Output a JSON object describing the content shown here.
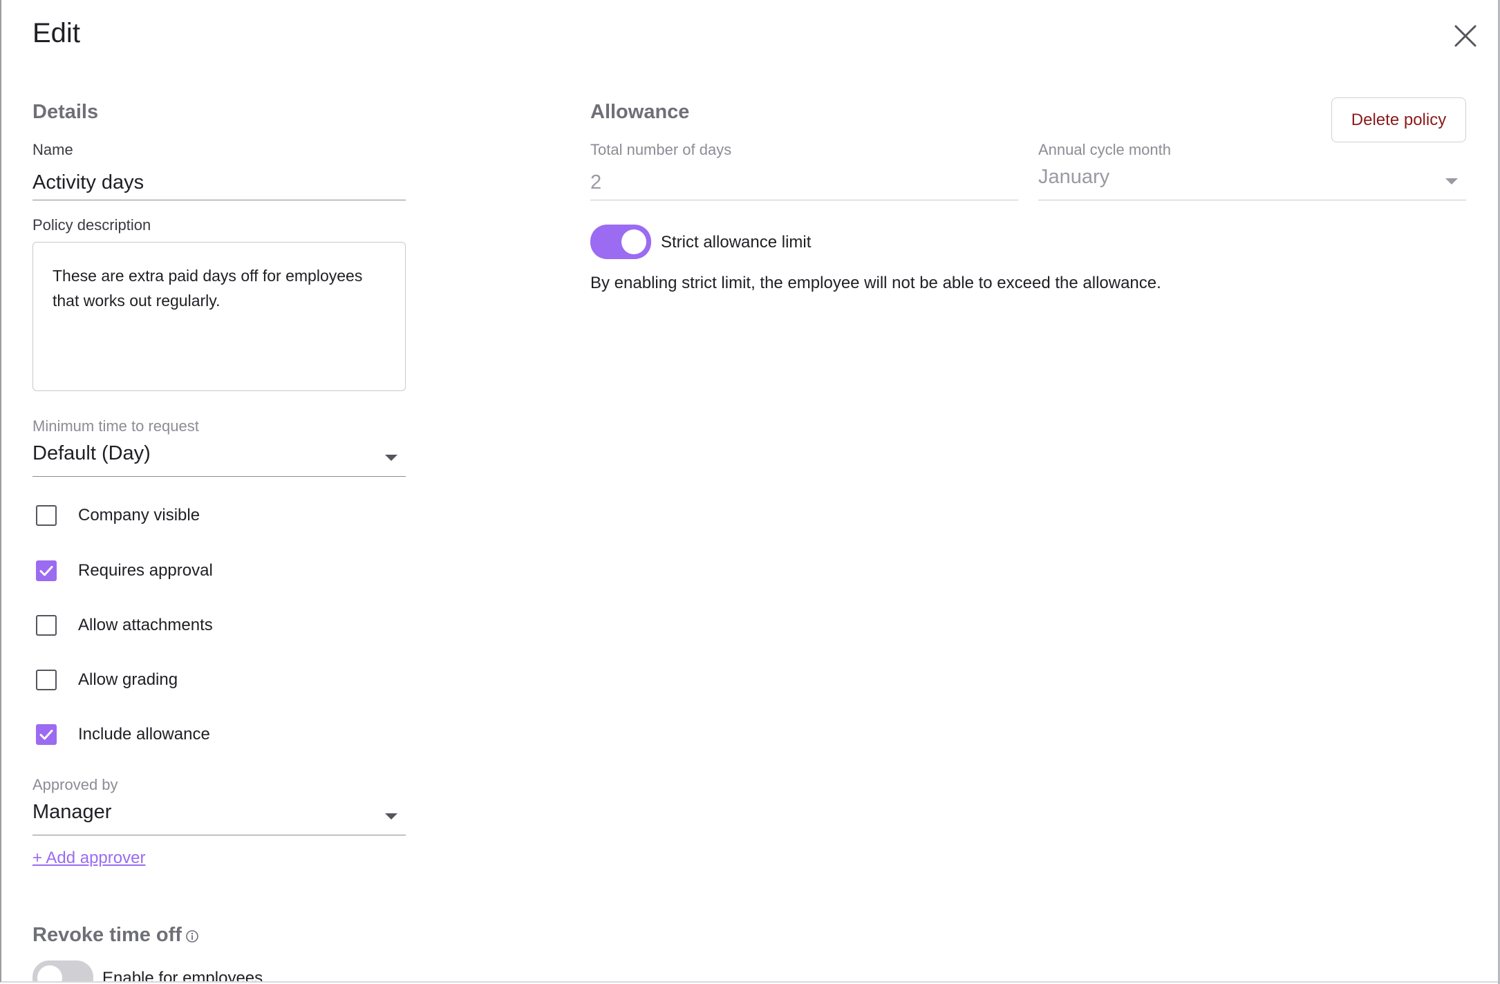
{
  "dialog": {
    "title": "Edit"
  },
  "details": {
    "heading": "Details",
    "name_label": "Name",
    "name_value": "Activity days",
    "description_label": "Policy description",
    "description_value": "These are extra paid days off for employees that works out regularly.",
    "min_time_label": "Minimum time to request",
    "min_time_value": "Default (Day)",
    "checkboxes": [
      {
        "label": "Company visible",
        "checked": false
      },
      {
        "label": "Requires approval",
        "checked": true
      },
      {
        "label": "Allow attachments",
        "checked": false
      },
      {
        "label": "Allow grading",
        "checked": false
      },
      {
        "label": "Include allowance",
        "checked": true
      }
    ],
    "approved_by_label": "Approved by",
    "approved_by_value": "Manager",
    "add_approver_label": "+ Add approver"
  },
  "revoke": {
    "heading": "Revoke time off",
    "toggle_label": "Enable for employees",
    "toggle_on": false
  },
  "allowance": {
    "heading": "Allowance",
    "delete_label": "Delete policy",
    "total_days_label": "Total number of days",
    "total_days_value": "2",
    "cycle_month_label": "Annual cycle month",
    "cycle_month_value": "January",
    "strict_limit_label": "Strict allowance limit",
    "strict_limit_on": true,
    "strict_limit_help": "By enabling strict limit, the employee will not be able to exceed the allowance."
  },
  "colors": {
    "accent": "#9b6bf2",
    "danger_text": "#8b1a1a",
    "section_heading": "#6f6f78"
  },
  "icons": {
    "close": "close-icon",
    "caret": "chevron-down-icon",
    "check": "check-icon",
    "info": "info-icon"
  }
}
